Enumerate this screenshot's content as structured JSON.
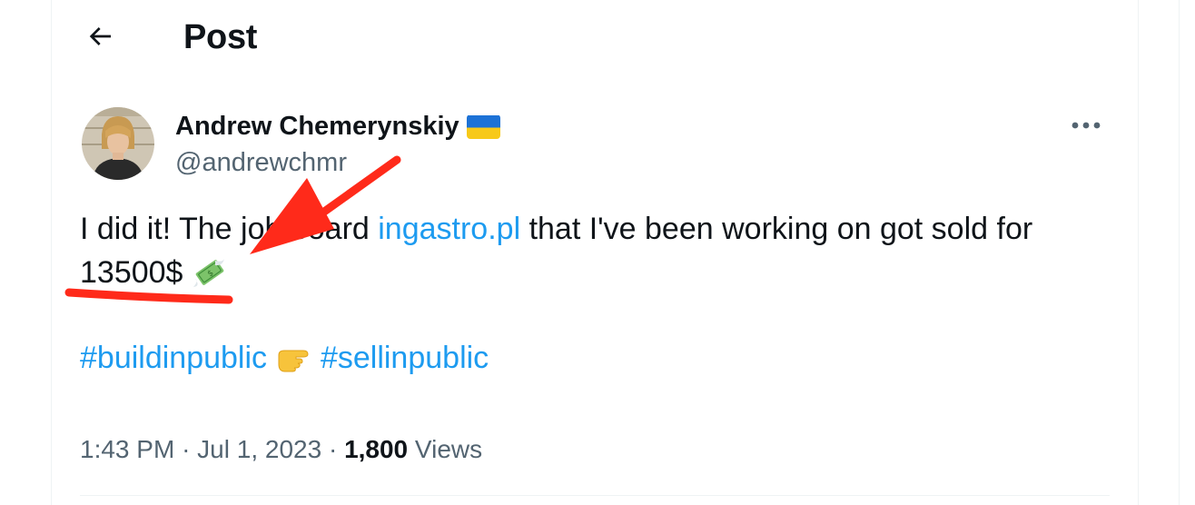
{
  "header": {
    "title": "Post",
    "back_icon": "arrow-left-icon"
  },
  "tweet": {
    "author": {
      "name": "Andrew Chemerynskiy",
      "flag_icon": "ukraine-flag-icon",
      "handle": "@andrewchmr",
      "avatar_icon": "avatar-photo"
    },
    "more_icon": "more-dots-icon",
    "text": {
      "part1": "I did it! The job board ",
      "link": "ingastro.pl",
      "part2": " that I've been working on got sold for",
      "amount": "13500$",
      "money_emoji_icon": "money-with-wings-icon"
    },
    "hashtags": {
      "tag1": "#buildinpublic",
      "pointing_emoji_icon": "backhand-index-pointing-right-icon",
      "tag2": "#sellinpublic"
    },
    "meta": {
      "time": "1:43 PM",
      "separator": "·",
      "date": "Jul 1, 2023",
      "views_count": "1,800",
      "views_label": "Views"
    }
  },
  "colors": {
    "link": "#1d9bf0",
    "secondary_text": "#536471",
    "annotation": "#ff2a1a"
  }
}
